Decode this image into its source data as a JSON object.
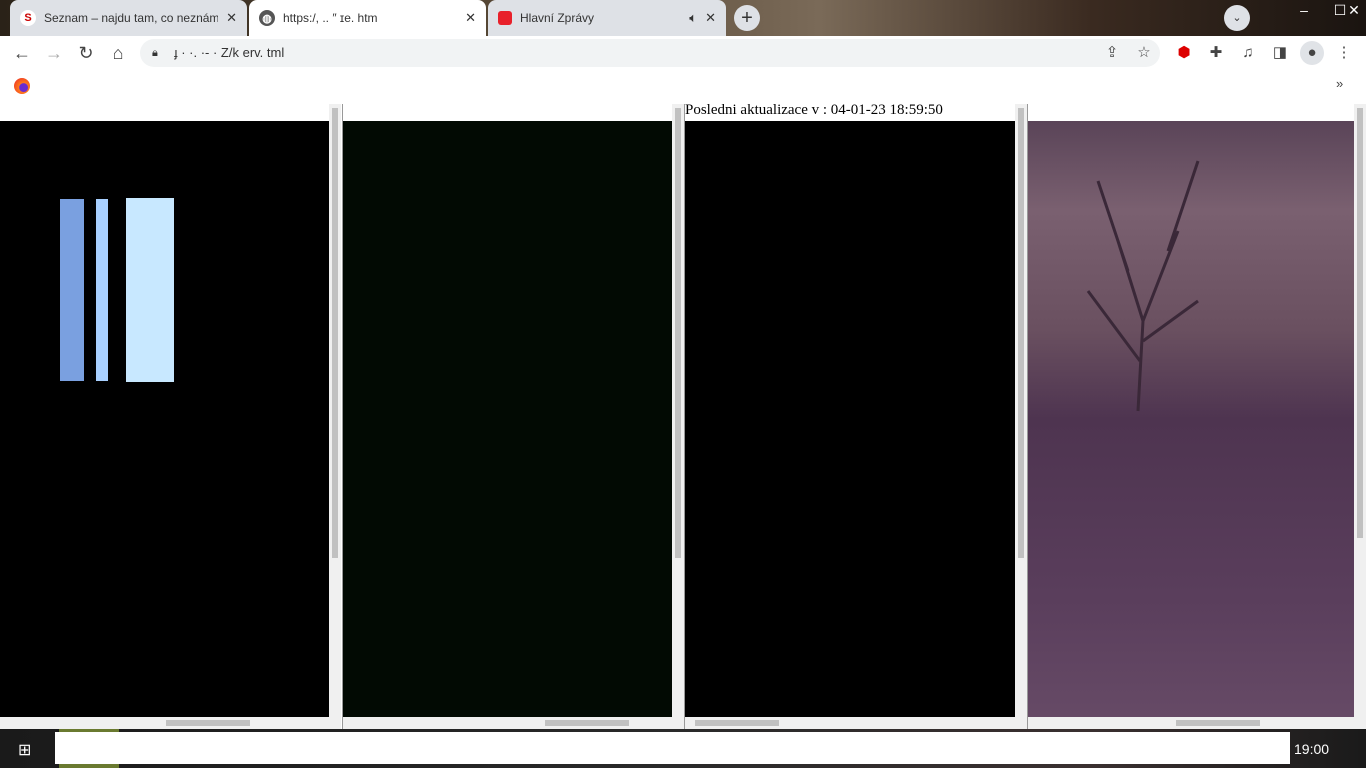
{
  "tabs": [
    {
      "title": "Seznam – najdu tam, co neznám",
      "icon": "seznam-icon",
      "fav_text": "S",
      "color": "#cc0000"
    },
    {
      "title": "https:/,        ..     ″   ɪe.  htm",
      "icon": "globe-icon",
      "active": true
    },
    {
      "title": "Hlavní Zprávy",
      "icon": "news-icon",
      "audio": true,
      "color": "#e8202a"
    }
  ],
  "address": "ɟ ·  ·. ·-     ·  Z/k    erv.  tml",
  "frame3_text": "Posledni aktualizace v : 04-01-23 18:59:50",
  "clock": "19:00",
  "colors": {
    "frame1": "#000000",
    "frame2": "#020a03",
    "frame3": "#000000",
    "frame4": "#5e4560"
  }
}
